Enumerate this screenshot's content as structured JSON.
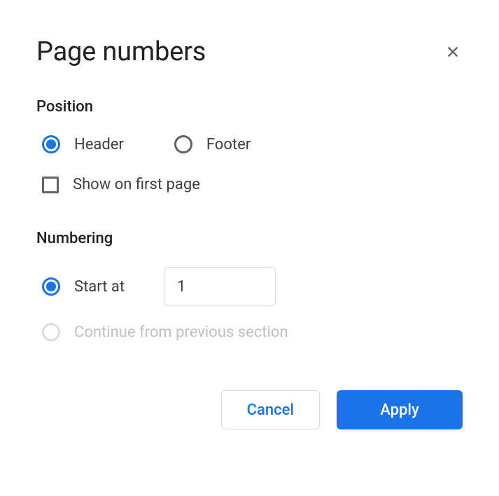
{
  "dialog": {
    "title": "Page numbers"
  },
  "position": {
    "section_label": "Position",
    "header_label": "Header",
    "footer_label": "Footer",
    "selected": "header",
    "show_first_page_label": "Show on first page",
    "show_first_page_checked": false
  },
  "numbering": {
    "section_label": "Numbering",
    "start_at_label": "Start at",
    "start_at_value": "1",
    "continue_label": "Continue from previous section",
    "selected": "start_at",
    "continue_disabled": true
  },
  "actions": {
    "cancel_label": "Cancel",
    "apply_label": "Apply"
  }
}
